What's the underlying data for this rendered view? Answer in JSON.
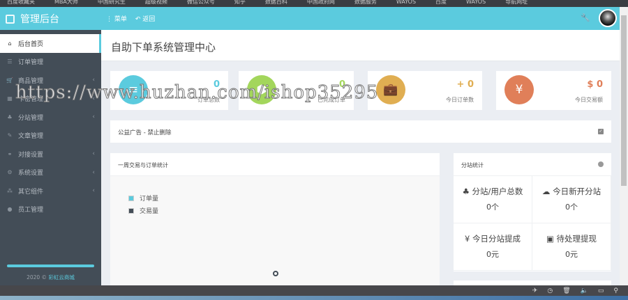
{
  "bookmarks": [
    "百度收藏夹",
    "MBA大师",
    "中国研究生",
    "超级视频",
    "微信公众号",
    "知乎",
    "数据百科",
    "中国政府网",
    "数据服务",
    "WAYOS",
    "百度",
    "WAYOS",
    "导航网址"
  ],
  "header": {
    "brand": "管理后台",
    "menu": "菜单",
    "back": "返回"
  },
  "sidebar": {
    "items": [
      {
        "icon": "⌂",
        "label": "后台首页",
        "chev": false
      },
      {
        "icon": "☰",
        "label": "订单管理",
        "chev": false
      },
      {
        "icon": "🛒",
        "label": "商品管理",
        "chev": true
      },
      {
        "icon": "▦",
        "label": "卡密管理",
        "chev": true
      },
      {
        "icon": "♣",
        "label": "分站管理",
        "chev": true
      },
      {
        "icon": "✎",
        "label": "文章管理",
        "chev": false
      },
      {
        "icon": "⚭",
        "label": "对接设置",
        "chev": true
      },
      {
        "icon": "⚙",
        "label": "系统设置",
        "chev": true
      },
      {
        "icon": "⁂",
        "label": "其它组件",
        "chev": true
      },
      {
        "icon": "●",
        "label": "员工管理",
        "chev": false
      }
    ],
    "footer_year": "2020 ©",
    "footer_link": "彩虹云商城"
  },
  "page_title": "自助下单系统管理中心",
  "cards": [
    {
      "value": "0",
      "label": "订单总数",
      "color": "#5bcbde",
      "icon": "≡"
    },
    {
      "value": "0",
      "label": "已完成订单",
      "color": "#a3d65c",
      "icon": "⬢"
    },
    {
      "value": "+ 0",
      "label": "今日订单数",
      "color": "#e0ae52",
      "icon": "💼"
    },
    {
      "value": "$ 0",
      "label": "今日交易额",
      "color": "#e07f59",
      "icon": "¥"
    }
  ],
  "notice": "公益广告 - 禁止删除",
  "chart_panel": {
    "title": "一周交易与订单统计",
    "legend": [
      {
        "label": "订单量",
        "color": "#5bcbde"
      },
      {
        "label": "交易量",
        "color": "#434d57"
      }
    ]
  },
  "chart_data": {
    "type": "line",
    "title": "一周交易与订单统计",
    "series": [
      {
        "name": "订单量",
        "values": []
      },
      {
        "name": "交易量",
        "values": []
      }
    ]
  },
  "stats_panel": {
    "title": "分站统计",
    "cells": [
      {
        "icon": "♣",
        "label": "分站/用户总数",
        "value": "0个"
      },
      {
        "icon": "☁",
        "label": "今日新开分站",
        "value": "0个"
      },
      {
        "icon": "¥",
        "label": "今日分站提成",
        "value": "0元"
      },
      {
        "icon": "▣",
        "label": "待处理提现",
        "value": "0元"
      }
    ]
  },
  "watermark": "https://www.huzhan.com/ishop35295"
}
